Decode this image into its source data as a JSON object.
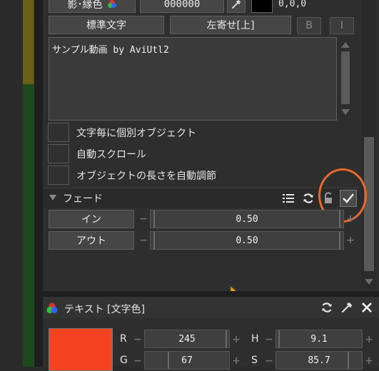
{
  "text_panel": {
    "shadow_label": "影･縁色",
    "shadow_color_value": "000000",
    "color_readout": "0,0,0",
    "font_button": "標準文字",
    "align_button": "左寄せ[上]",
    "bold_button": "B",
    "italic_button": "I",
    "text_content": "サンプル動画 by AviUtl2",
    "checkboxes": [
      {
        "label": "文字毎に個別オブジェクト",
        "checked": false
      },
      {
        "label": "自動スクロール",
        "checked": false
      },
      {
        "label": "オブジェクトの長さを自動調節",
        "checked": false
      }
    ]
  },
  "fade": {
    "title": "フェード",
    "enabled": true,
    "rows": [
      {
        "label": "イン",
        "value": "0.50"
      },
      {
        "label": "アウト",
        "value": "0.50"
      }
    ]
  },
  "color_panel": {
    "title": "テキスト [文字色]",
    "swatch_color": "#f54322",
    "rgb": [
      {
        "label": "R",
        "value": "245"
      },
      {
        "label": "G",
        "value": "67"
      }
    ],
    "hsv": [
      {
        "label": "H",
        "value": "9.1"
      },
      {
        "label": "S",
        "value": "85.7"
      }
    ]
  },
  "colors": {
    "accent_orange": "#e8692a",
    "cursor": "#f0a000"
  }
}
